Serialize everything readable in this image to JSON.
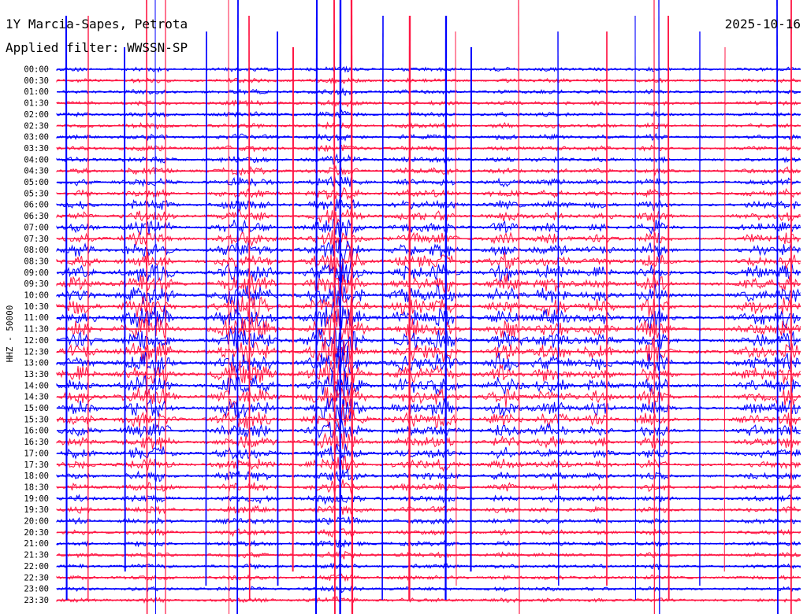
{
  "header": {
    "title": "1Y Marcia-Sapes, Petrota",
    "date": "2025-10-16",
    "filter": "Applied filter: WWSSN-SP"
  },
  "colors": {
    "trace_a": "#0000ff",
    "trace_b": "#ff1744",
    "background": "#ffffff",
    "text": "#000000"
  },
  "chart_data": {
    "type": "line",
    "title": "1Y Marcia-Sapes, Petrota",
    "subtitle": "Applied filter: WWSSN-SP",
    "ylabel": "HHZ - 50000",
    "xlabel": "",
    "date": "2025-10-16",
    "row_interval_minutes": 30,
    "tick_labels": [
      "00:00",
      "00:30",
      "01:00",
      "01:30",
      "02:00",
      "02:30",
      "03:00",
      "03:30",
      "04:00",
      "04:30",
      "05:00",
      "05:30",
      "06:00",
      "06:30",
      "07:00",
      "07:30",
      "08:00",
      "08:30",
      "09:00",
      "09:30",
      "10:00",
      "10:30",
      "11:00",
      "11:30",
      "12:00",
      "12:30",
      "13:00",
      "13:30",
      "14:00",
      "14:30",
      "15:00",
      "15:30",
      "16:00",
      "16:30",
      "17:00",
      "17:30",
      "18:00",
      "18:30",
      "19:00",
      "19:30",
      "20:00",
      "20:30",
      "21:00",
      "21:30",
      "22:00",
      "22:30",
      "23:00",
      "23:30"
    ],
    "series": [
      {
        "color": "#0000ff",
        "rows": "00:00, 01:00, 02:00, ... (even rows)"
      },
      {
        "color": "#ff1744",
        "rows": "00:30, 01:30, 02:30, ... (odd rows)"
      }
    ],
    "grid": false,
    "legend": "none"
  }
}
